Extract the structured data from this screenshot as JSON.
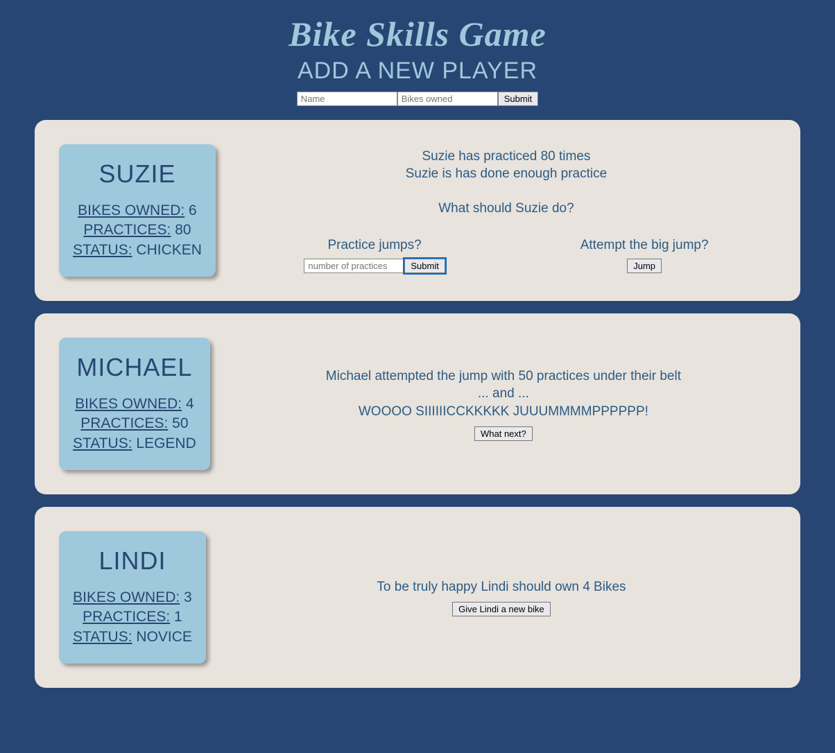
{
  "header": {
    "title": "Bike Skills Game",
    "subtitle": "ADD A NEW PLAYER",
    "name_placeholder": "Name",
    "bikes_placeholder": "Bikes owned",
    "submit_label": "Submit"
  },
  "labels": {
    "bikes_owned": "BIKES OWNED:",
    "practices": "PRACTICES:",
    "status": "STATUS:"
  },
  "players": [
    {
      "name": "SUZIE",
      "bikes_owned": "6",
      "practices": "80",
      "status": "CHICKEN",
      "content": {
        "line1": "Suzie has practiced 80 times",
        "line2": "Suzie is has done enough practice",
        "question": "What should Suzie do?",
        "practice_label": "Practice jumps?",
        "practice_placeholder": "number of practices",
        "practice_submit": "Submit",
        "attempt_label": "Attempt the big jump?",
        "jump_button": "Jump"
      }
    },
    {
      "name": "MICHAEL",
      "bikes_owned": "4",
      "practices": "50",
      "status": "LEGEND",
      "content": {
        "line1": "Michael attempted the jump with 50 practices under their belt",
        "line2": "... and ...",
        "line3": "WOOOO SIIIIIICCKKKKK JUUUMMMMPPPPPP!",
        "next_button": "What next?"
      }
    },
    {
      "name": "LINDI",
      "bikes_owned": "3",
      "practices": "1",
      "status": "NOVICE",
      "content": {
        "line1": "To be truly happy Lindi should own 4 Bikes",
        "give_button": "Give Lindi a new bike"
      }
    }
  ]
}
